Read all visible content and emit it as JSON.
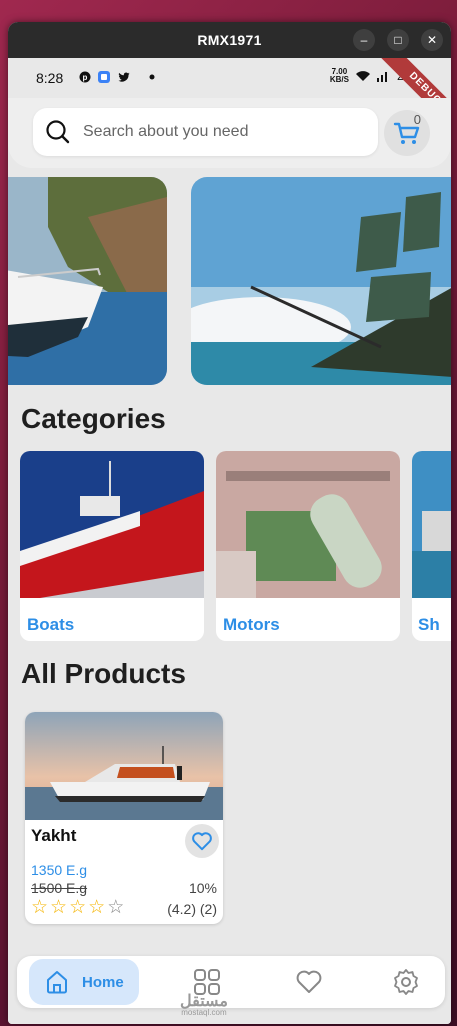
{
  "window": {
    "title": "RMX1971"
  },
  "status_bar": {
    "time": "8:28",
    "net_speed_value": "7.00",
    "net_speed_unit": "KB/S",
    "battery": "22%"
  },
  "debug_banner": "DEBUG",
  "search": {
    "placeholder": "Search about you need"
  },
  "cart": {
    "count": "0"
  },
  "categories": {
    "title": "Categories",
    "items": [
      {
        "label": "Boats"
      },
      {
        "label": "Motors"
      },
      {
        "label": "Sh"
      }
    ]
  },
  "all_products": {
    "title": "All Products",
    "items": [
      {
        "name": "Yakht",
        "price": "1350 E.g",
        "old_price": "1500 E.g",
        "discount": "10%",
        "rating": "(4.2) (2)",
        "stars": 4,
        "stars_total": 5
      }
    ]
  },
  "bottom_nav": {
    "home_label": "Home",
    "watermark": "مستقل",
    "watermark_sub": "mostaql.com"
  },
  "colors": {
    "accent": "#2d8ee6",
    "accent_light": "#d6e7fb",
    "star": "#f5b400"
  }
}
